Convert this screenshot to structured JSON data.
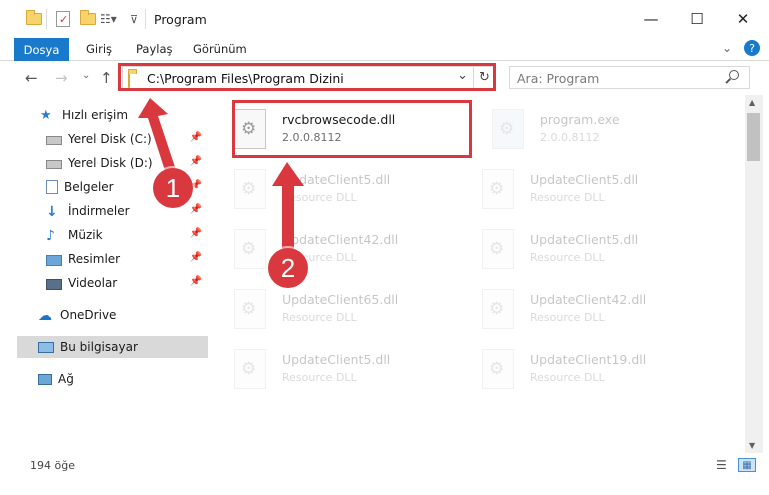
{
  "window": {
    "title": "Program",
    "controls": {
      "minimize": "—",
      "maximize": "☐",
      "close": "✕"
    }
  },
  "ribbon": {
    "tabs": [
      "Dosya",
      "Giriş",
      "Paylaş",
      "Görünüm"
    ],
    "help": "?"
  },
  "navbar": {
    "back": "←",
    "forward": "→",
    "up": "↑",
    "path": "C:\\Program Files\\Program Dizini",
    "dropdown": "⌄",
    "refresh": "↻",
    "search_placeholder": "Ara: Program",
    "search_icon": "search-icon"
  },
  "sidebar": {
    "items": [
      {
        "label": "Hızlı erişim",
        "icon": "star-icon",
        "pinned": false
      },
      {
        "label": "Yerel Disk (C:)",
        "icon": "drive-icon",
        "pinned": true
      },
      {
        "label": "Yerel Disk (D:)",
        "icon": "drive-icon",
        "pinned": true
      },
      {
        "label": "Belgeler",
        "icon": "documents-icon",
        "pinned": true
      },
      {
        "label": "İndirmeler",
        "icon": "download-icon",
        "pinned": true
      },
      {
        "label": "Müzik",
        "icon": "music-icon",
        "pinned": true
      },
      {
        "label": "Resimler",
        "icon": "pictures-icon",
        "pinned": true
      },
      {
        "label": "Videolar",
        "icon": "videos-icon",
        "pinned": true
      },
      {
        "label": "OneDrive",
        "icon": "cloud-icon",
        "pinned": false
      },
      {
        "label": "Bu bilgisayar",
        "icon": "computer-icon",
        "pinned": false,
        "selected": true
      },
      {
        "label": "Ağ",
        "icon": "network-icon",
        "pinned": false
      }
    ],
    "pin_glyph": "📌"
  },
  "files": [
    {
      "name": "rvcbrowsecode.dll",
      "sub": "2.0.0.8112"
    },
    {
      "name": "program.exe",
      "sub": "2.0.0.8112"
    },
    {
      "name": "UpdateClient5.dll",
      "sub": "Resource DLL"
    },
    {
      "name": "UpdateClient5.dll",
      "sub": "Resource DLL"
    },
    {
      "name": "UpdateClient42.dll",
      "sub": "Resource DLL"
    },
    {
      "name": "UpdateClient5.dll",
      "sub": "Resource DLL"
    },
    {
      "name": "UpdateClient65.dll",
      "sub": "Resource DLL"
    },
    {
      "name": "UpdateClient42.dll",
      "sub": "Resource DLL"
    },
    {
      "name": "UpdateClient5.dll",
      "sub": "Resource DLL"
    },
    {
      "name": "UpdateClient19.dll",
      "sub": "Resource DLL"
    }
  ],
  "status": {
    "count": "194 öğe"
  },
  "annotations": {
    "step1": "1",
    "step2": "2",
    "color": "#d9383f"
  },
  "colors": {
    "accent": "#1979ca",
    "selected_nav": "#d9d9d9"
  }
}
